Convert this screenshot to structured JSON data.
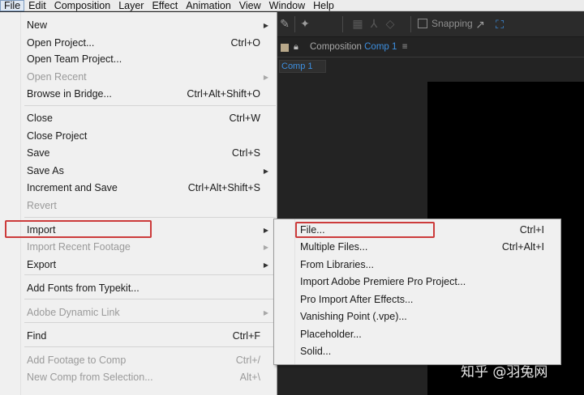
{
  "menubar": {
    "items": [
      "File",
      "Edit",
      "Composition",
      "Layer",
      "Effect",
      "Animation",
      "View",
      "Window",
      "Help"
    ]
  },
  "toolbar": {
    "snapping_label": "Snapping"
  },
  "composition_panel": {
    "panel_prefix": "Composition",
    "comp_name": "Comp 1",
    "tab_label": "Comp 1",
    "menu_icon": "hamburger-icon"
  },
  "file_menu": {
    "items": [
      {
        "label": "New",
        "shortcut": "",
        "submenu": true,
        "disabled": false
      },
      {
        "label": "Open Project...",
        "shortcut": "Ctrl+O",
        "submenu": false,
        "disabled": false
      },
      {
        "label": "Open Team Project...",
        "shortcut": "",
        "submenu": false,
        "disabled": false
      },
      {
        "label": "Open Recent",
        "shortcut": "",
        "submenu": true,
        "disabled": true
      },
      {
        "label": "Browse in Bridge...",
        "shortcut": "Ctrl+Alt+Shift+O",
        "submenu": false,
        "disabled": false
      },
      {
        "label": "Close",
        "shortcut": "Ctrl+W",
        "submenu": false,
        "disabled": false
      },
      {
        "label": "Close Project",
        "shortcut": "",
        "submenu": false,
        "disabled": false
      },
      {
        "label": "Save",
        "shortcut": "Ctrl+S",
        "submenu": false,
        "disabled": false
      },
      {
        "label": "Save As",
        "shortcut": "",
        "submenu": true,
        "disabled": false
      },
      {
        "label": "Increment and Save",
        "shortcut": "Ctrl+Alt+Shift+S",
        "submenu": false,
        "disabled": false
      },
      {
        "label": "Revert",
        "shortcut": "",
        "submenu": false,
        "disabled": true
      },
      {
        "label": "Import",
        "shortcut": "",
        "submenu": true,
        "disabled": false
      },
      {
        "label": "Import Recent Footage",
        "shortcut": "",
        "submenu": true,
        "disabled": true
      },
      {
        "label": "Export",
        "shortcut": "",
        "submenu": true,
        "disabled": false
      },
      {
        "label": "Add Fonts from Typekit...",
        "shortcut": "",
        "submenu": false,
        "disabled": false
      },
      {
        "label": "Adobe Dynamic Link",
        "shortcut": "",
        "submenu": true,
        "disabled": true
      },
      {
        "label": "Find",
        "shortcut": "Ctrl+F",
        "submenu": false,
        "disabled": false
      },
      {
        "label": "Add Footage to Comp",
        "shortcut": "Ctrl+/",
        "submenu": false,
        "disabled": true
      },
      {
        "label": "New Comp from Selection...",
        "shortcut": "Alt+\\",
        "submenu": false,
        "disabled": true
      }
    ]
  },
  "import_submenu": {
    "items": [
      {
        "label": "File...",
        "shortcut": "Ctrl+I"
      },
      {
        "label": "Multiple Files...",
        "shortcut": "Ctrl+Alt+I"
      },
      {
        "label": "From Libraries...",
        "shortcut": ""
      },
      {
        "label": "Import Adobe Premiere Pro Project...",
        "shortcut": ""
      },
      {
        "label": "Pro Import After Effects...",
        "shortcut": ""
      },
      {
        "label": "Vanishing Point (.vpe)...",
        "shortcut": ""
      },
      {
        "label": "Placeholder...",
        "shortcut": ""
      },
      {
        "label": "Solid...",
        "shortcut": ""
      }
    ]
  },
  "watermark": "知乎 @羽兔网",
  "colors": {
    "highlight_box": "#cc3b3b",
    "comp_name_accent": "#3d8fe0"
  }
}
